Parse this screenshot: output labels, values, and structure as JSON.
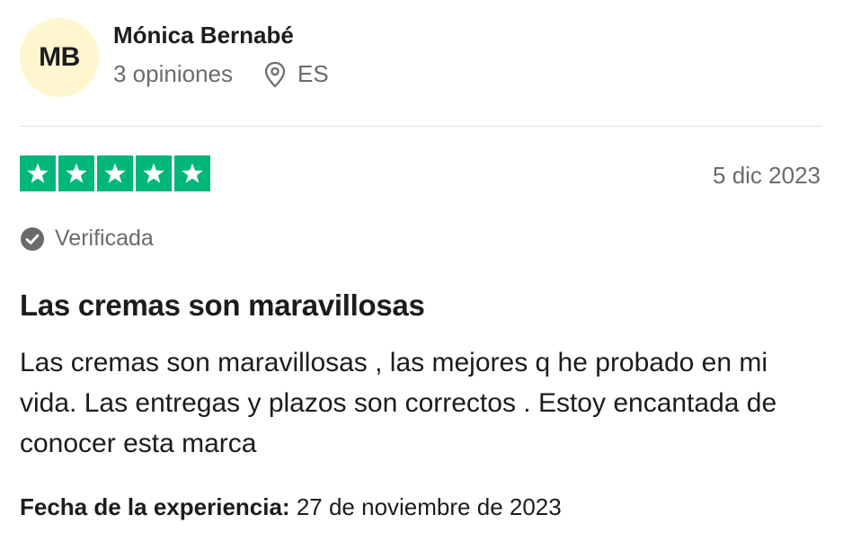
{
  "consumer": {
    "initials": "MB",
    "name": "Mónica Bernabé",
    "reviews_count": "3 opiniones",
    "country": "ES",
    "avatar_color": "#fdf6cf",
    "location_icon": "map-pin-icon"
  },
  "review": {
    "rating": 5,
    "max_rating": 5,
    "star_color": "#00b67a",
    "date": "5 dic 2023",
    "verified_label": "Verificada",
    "verified_icon": "check-circle-icon",
    "title": "Las cremas son maravillosas",
    "text": "Las cremas son maravillosas , las mejores q he probado en mi vida. Las entregas y plazos son correctos . Estoy encantada de conocer esta marca",
    "experience_label": "Fecha de la experiencia:",
    "experience_date": "27 de noviembre de 2023"
  }
}
